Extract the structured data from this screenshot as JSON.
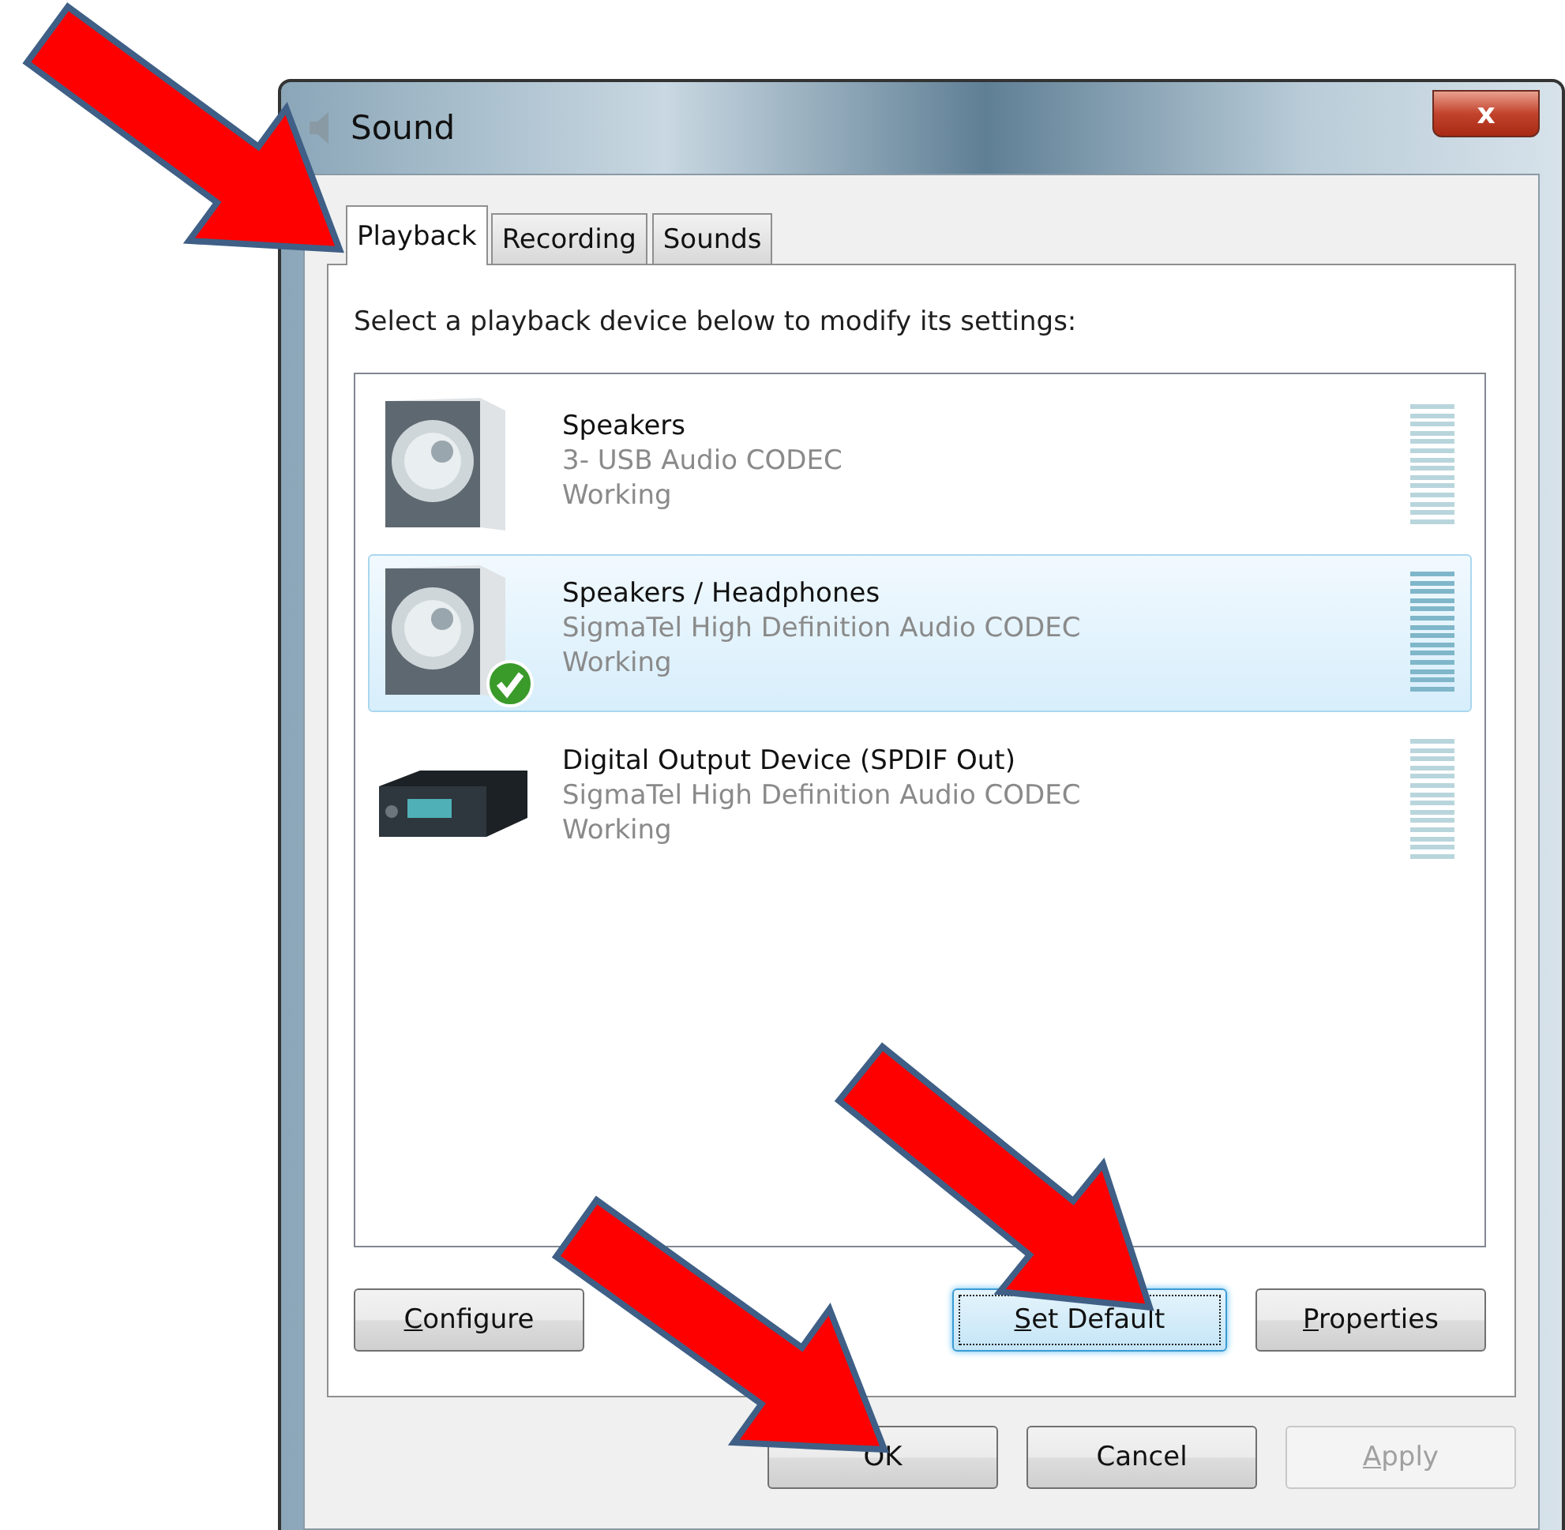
{
  "window": {
    "title": "Sound",
    "close_glyph": "x"
  },
  "tabs": [
    {
      "label": "Playback",
      "selected": true
    },
    {
      "label": "Recording",
      "selected": false
    },
    {
      "label": "Sounds",
      "selected": false
    }
  ],
  "instruction": "Select a playback device below to modify its settings:",
  "devices": [
    {
      "kind": "speaker",
      "name": "Speakers",
      "driver": "3- USB Audio CODEC",
      "status": "Working",
      "selected": false,
      "default": false
    },
    {
      "kind": "speaker",
      "name": "Speakers / Headphones",
      "driver": "SigmaTel High Definition Audio CODEC",
      "status": "Working",
      "selected": true,
      "default": true
    },
    {
      "kind": "digital",
      "name": "Digital Output Device (SPDIF Out)",
      "driver": "SigmaTel High Definition Audio CODEC",
      "status": "Working",
      "selected": false,
      "default": false
    }
  ],
  "left_buttons": [
    {
      "label": "Configure",
      "mnemonic": true,
      "focused": false
    }
  ],
  "right_buttons": [
    {
      "label": "Set Default",
      "mnemonic": true,
      "focused": true
    },
    {
      "label": "Properties",
      "mnemonic": true,
      "focused": false
    }
  ],
  "dialog_buttons": [
    {
      "label": "OK",
      "mnemonic": false,
      "disabled": false
    },
    {
      "label": "Cancel",
      "mnemonic": false,
      "disabled": false
    },
    {
      "label": "Apply",
      "mnemonic": true,
      "disabled": true
    }
  ]
}
